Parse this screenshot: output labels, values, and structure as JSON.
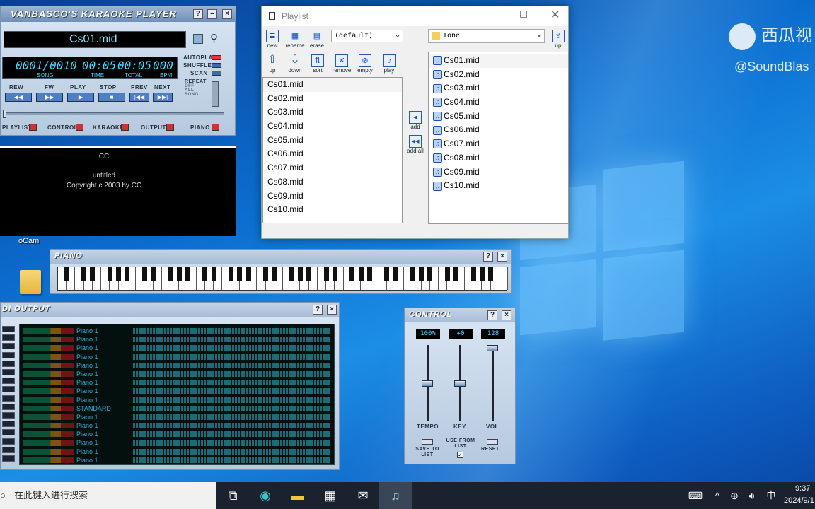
{
  "desktop": {
    "watermark": "西瓜视",
    "watermark_handle": "@SoundBlas",
    "folder_label": "oCam"
  },
  "karaoke": {
    "title": "VANBASCO'S KARAOKE PLAYER",
    "file": "Cs01.mid",
    "lcd": {
      "song": "0001/0010",
      "time": "00:05",
      "total": "00:05",
      "bpm": "000"
    },
    "lcd_labels": {
      "song": "SONG",
      "time": "TIME",
      "total": "TOTAL",
      "bpm": "BPM"
    },
    "toggles": [
      "AUTOPLAY",
      "SHUFFLE",
      "SCAN"
    ],
    "repeat": {
      "label": "REPEAT",
      "options": [
        "OFF",
        "ALL",
        "SONG"
      ]
    },
    "transport": [
      "REW",
      "FW",
      "PLAY",
      "STOP",
      "PREV",
      "NEXT"
    ],
    "panels": [
      "PLAYLIST",
      "CONTROL",
      "KARAOKE",
      "OUTPUT",
      "PIANO"
    ],
    "help": "?",
    "close": "×"
  },
  "lyrics": {
    "line1": "CC",
    "line2": "untitled",
    "line3": "Copyright c 2003 by CC"
  },
  "playlist": {
    "title": "Playlist",
    "toolbar1": [
      "new",
      "rename",
      "erase"
    ],
    "select_value": "(default)",
    "toolbar2": [
      "up",
      "down",
      "sort",
      "remove",
      "empty",
      "play!"
    ],
    "items": [
      "Cs01.mid",
      "Cs02.mid",
      "Cs03.mid",
      "Cs04.mid",
      "Cs05.mid",
      "Cs06.mid",
      "Cs07.mid",
      "Cs08.mid",
      "Cs09.mid",
      "Cs10.mid"
    ],
    "add": "add",
    "add_all": "add all",
    "folder_value": "Tone",
    "folder_up": "up",
    "files": [
      "Cs01.mid",
      "Cs02.mid",
      "Cs03.mid",
      "Cs04.mid",
      "Cs05.mid",
      "Cs06.mid",
      "Cs07.mid",
      "Cs08.mid",
      "Cs09.mid",
      "Cs10.mid"
    ]
  },
  "piano": {
    "title": "PIANO",
    "help": "?",
    "close": "×"
  },
  "midi_output": {
    "title": "DI OUTPUT",
    "help": "?",
    "close": "×",
    "channels": [
      "Piano 1",
      "Piano 1",
      "Piano 1",
      "Piano 1",
      "Piano 1",
      "Piano 1",
      "Piano 1",
      "Piano 1",
      "Piano 1",
      "STANDARD",
      "Piano 1",
      "Piano 1",
      "Piano 1",
      "Piano 1",
      "Piano 1",
      "Piano 1"
    ]
  },
  "control": {
    "title": "CONTROL",
    "help": "?",
    "close": "×",
    "tempo_value": "100%",
    "key_value": "+0",
    "vol_value": "128",
    "tempo_label": "TEMPO",
    "key_label": "KEY",
    "vol_label": "VOL",
    "tempo_level": 0.5,
    "key_level": 0.5,
    "vol_level": 1.0,
    "save_label": "SAVE TO LIST",
    "use_label": "USE FROM LIST",
    "reset_label": "RESET"
  },
  "taskbar": {
    "search_placeholder": "在此键入进行搜索",
    "time": "9:37",
    "date": "2024/9/1",
    "ime": "中"
  }
}
